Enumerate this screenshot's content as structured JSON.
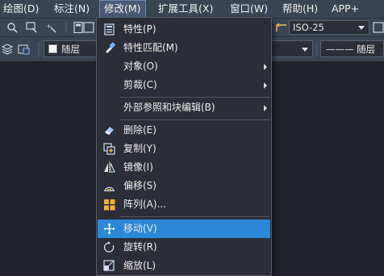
{
  "menubar": {
    "items": [
      {
        "label": "绘图(D)"
      },
      {
        "label": "标注(N)"
      },
      {
        "label": "修改(M)"
      },
      {
        "label": "扩展工具(X)"
      },
      {
        "label": "窗口(W)"
      },
      {
        "label": "帮助(H)"
      },
      {
        "label": "APP+"
      }
    ]
  },
  "toolbar": {
    "dimstyle_value": "ISO-25",
    "layer_color_value": "随层",
    "linetype_value": "随层",
    "lineweight_value": "——— 随层"
  },
  "modify_menu": {
    "items": [
      {
        "label": "特性(P)",
        "icon": "properties-icon"
      },
      {
        "label": "特性匹配(M)",
        "icon": "match-properties-icon"
      },
      {
        "label": "对象(O)",
        "submenu": true
      },
      {
        "label": "剪裁(C)",
        "submenu": true
      },
      {
        "label": "外部参照和块编辑(B)",
        "submenu": true
      },
      {
        "label": "删除(E)",
        "icon": "erase-icon"
      },
      {
        "label": "复制(Y)",
        "icon": "copy-icon"
      },
      {
        "label": "镜像(I)",
        "icon": "mirror-icon"
      },
      {
        "label": "偏移(S)",
        "icon": "offset-icon"
      },
      {
        "label": "阵列(A)...",
        "icon": "array-icon"
      },
      {
        "label": "移动(V)",
        "icon": "move-icon",
        "highlighted": true
      },
      {
        "label": "旋转(R)",
        "icon": "rotate-icon"
      },
      {
        "label": "缩放(L)",
        "icon": "scale-icon"
      }
    ]
  },
  "colors": {
    "menu_highlight": "#2b88d8",
    "menubar_bg": "#3b4453",
    "menu_bg": "#2b2e36",
    "canvas_bg": "#1f222a"
  }
}
